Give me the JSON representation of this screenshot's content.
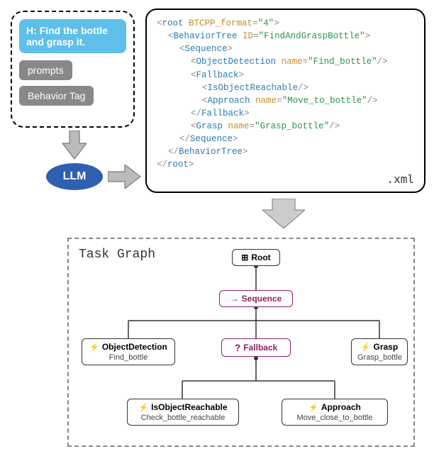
{
  "input": {
    "instruction": "H: Find the bottle and grasp it.",
    "tag1": "prompts",
    "tag2": "Behavior Tag"
  },
  "llm_label": "LLM",
  "xml": {
    "lines": [
      {
        "indent": 0,
        "parts": [
          {
            "t": "punct",
            "v": "<"
          },
          {
            "t": "kw",
            "v": "root"
          },
          {
            "t": "plain",
            "v": " "
          },
          {
            "t": "attr",
            "v": "BTCPP_format"
          },
          {
            "t": "punct",
            "v": "="
          },
          {
            "t": "val",
            "v": "\"4\""
          },
          {
            "t": "punct",
            "v": ">"
          }
        ]
      },
      {
        "indent": 1,
        "parts": [
          {
            "t": "punct",
            "v": "<"
          },
          {
            "t": "kw",
            "v": "BehaviorTree"
          },
          {
            "t": "plain",
            "v": " "
          },
          {
            "t": "attr",
            "v": "ID"
          },
          {
            "t": "punct",
            "v": "="
          },
          {
            "t": "val",
            "v": "\"FindAndGraspBottle\""
          },
          {
            "t": "punct",
            "v": ">"
          }
        ]
      },
      {
        "indent": 2,
        "parts": [
          {
            "t": "punct",
            "v": "<"
          },
          {
            "t": "kw",
            "v": "Sequence"
          },
          {
            "t": "punct",
            "v": ">"
          }
        ]
      },
      {
        "indent": 3,
        "parts": [
          {
            "t": "punct",
            "v": "<"
          },
          {
            "t": "kw",
            "v": "ObjectDetection"
          },
          {
            "t": "plain",
            "v": " "
          },
          {
            "t": "attr",
            "v": "name"
          },
          {
            "t": "punct",
            "v": "="
          },
          {
            "t": "val",
            "v": "\"Find_bottle\""
          },
          {
            "t": "punct",
            "v": "/>"
          }
        ]
      },
      {
        "indent": 3,
        "parts": [
          {
            "t": "punct",
            "v": "<"
          },
          {
            "t": "kw",
            "v": "Fallback"
          },
          {
            "t": "punct",
            "v": ">"
          }
        ]
      },
      {
        "indent": 4,
        "parts": [
          {
            "t": "punct",
            "v": "<"
          },
          {
            "t": "kw",
            "v": "IsObjectReachable"
          },
          {
            "t": "punct",
            "v": "/>"
          }
        ]
      },
      {
        "indent": 4,
        "parts": [
          {
            "t": "punct",
            "v": "<"
          },
          {
            "t": "kw",
            "v": "Approach"
          },
          {
            "t": "plain",
            "v": " "
          },
          {
            "t": "attr",
            "v": "name"
          },
          {
            "t": "punct",
            "v": "="
          },
          {
            "t": "val",
            "v": "\"Move_to_bottle\""
          },
          {
            "t": "punct",
            "v": "/>"
          }
        ]
      },
      {
        "indent": 3,
        "parts": [
          {
            "t": "punct",
            "v": "</"
          },
          {
            "t": "kw",
            "v": "Fallback"
          },
          {
            "t": "punct",
            "v": ">"
          }
        ]
      },
      {
        "indent": 3,
        "parts": [
          {
            "t": "punct",
            "v": "<"
          },
          {
            "t": "kw",
            "v": "Grasp"
          },
          {
            "t": "plain",
            "v": " "
          },
          {
            "t": "attr",
            "v": "name"
          },
          {
            "t": "punct",
            "v": "="
          },
          {
            "t": "val",
            "v": "\"Grasp_bottle\""
          },
          {
            "t": "punct",
            "v": "/>"
          }
        ]
      },
      {
        "indent": 2,
        "parts": [
          {
            "t": "punct",
            "v": "</"
          },
          {
            "t": "kw",
            "v": "Sequence"
          },
          {
            "t": "punct",
            "v": ">"
          }
        ]
      },
      {
        "indent": 1,
        "parts": [
          {
            "t": "punct",
            "v": "</"
          },
          {
            "t": "kw",
            "v": "BehaviorTree"
          },
          {
            "t": "punct",
            "v": ">"
          }
        ]
      },
      {
        "indent": 0,
        "parts": [
          {
            "t": "punct",
            "v": "</"
          },
          {
            "t": "kw",
            "v": "root"
          },
          {
            "t": "punct",
            "v": ">"
          }
        ]
      }
    ],
    "ext": ".xml"
  },
  "graph": {
    "title": "Task Graph",
    "nodes": {
      "root": {
        "title": "Root"
      },
      "sequence": {
        "title": "Sequence"
      },
      "objdet": {
        "title": "ObjectDetection",
        "sub": "Find_bottle"
      },
      "fallback": {
        "title": "Fallback"
      },
      "grasp": {
        "title": "Grasp",
        "sub": "Grasp_bottle"
      },
      "isreach": {
        "title": "IsObjectReachable",
        "sub": "Check_bottle_reachable"
      },
      "approach": {
        "title": "Approach",
        "sub": "Move_close_to_bottle"
      }
    }
  },
  "chart_data": {
    "type": "diagram",
    "flow": [
      {
        "from": "input-box",
        "to": "LLM"
      },
      {
        "from": "LLM",
        "to": "xml-output"
      },
      {
        "from": "xml-output",
        "to": "task-graph"
      }
    ],
    "behavior_tree": {
      "root": {
        "type": "Root",
        "children": [
          {
            "type": "Sequence",
            "children": [
              {
                "type": "ObjectDetection",
                "name": "Find_bottle"
              },
              {
                "type": "Fallback",
                "children": [
                  {
                    "type": "IsObjectReachable",
                    "name": "Check_bottle_reachable"
                  },
                  {
                    "type": "Approach",
                    "name": "Move_close_to_bottle"
                  }
                ]
              },
              {
                "type": "Grasp",
                "name": "Grasp_bottle"
              }
            ]
          }
        ]
      }
    }
  }
}
